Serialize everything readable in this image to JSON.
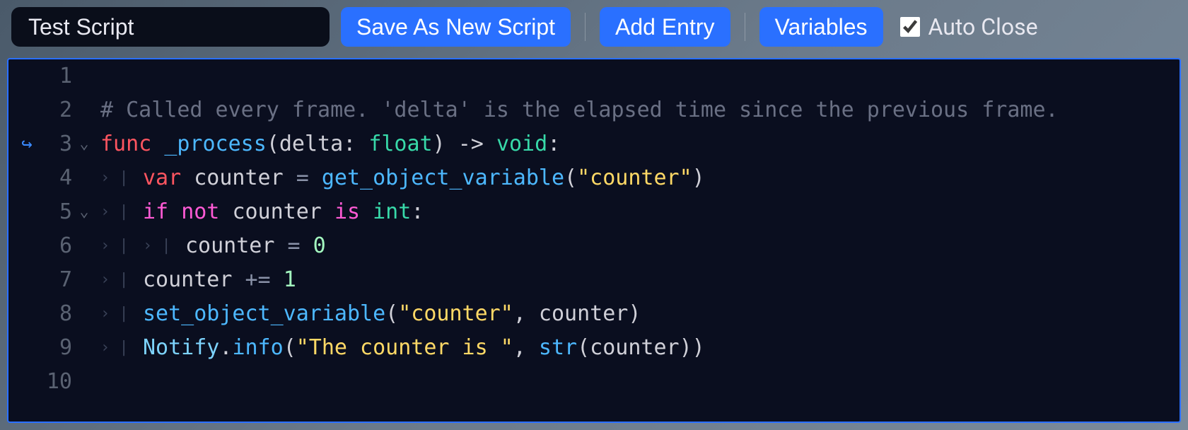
{
  "toolbar": {
    "script_name": "Test Script",
    "save_label": "Save As New Script",
    "add_entry_label": "Add Entry",
    "variables_label": "Variables",
    "auto_close_label": "Auto Close",
    "auto_close_checked": true
  },
  "editor": {
    "lines": [
      {
        "num": "1",
        "gutter": "",
        "fold": "",
        "indent": "",
        "tokens": []
      },
      {
        "num": "2",
        "gutter": "",
        "fold": "",
        "indent": "",
        "tokens": [
          {
            "t": "# Called every frame. 'delta' is the elapsed time since the previous frame.",
            "c": "c-comment"
          }
        ]
      },
      {
        "num": "3",
        "gutter": "↪",
        "fold": "⌄",
        "indent": "",
        "tokens": [
          {
            "t": "func ",
            "c": "c-key-func"
          },
          {
            "t": "_process",
            "c": "c-funcname"
          },
          {
            "t": "(",
            "c": "c-punc"
          },
          {
            "t": "delta",
            "c": "c-ident"
          },
          {
            "t": ": ",
            "c": "c-punc"
          },
          {
            "t": "float",
            "c": "c-type"
          },
          {
            "t": ") -> ",
            "c": "c-punc"
          },
          {
            "t": "void",
            "c": "c-type"
          },
          {
            "t": ":",
            "c": "c-punc"
          }
        ]
      },
      {
        "num": "4",
        "gutter": "",
        "fold": "",
        "indent": "›|  ",
        "tokens": [
          {
            "t": "var ",
            "c": "c-key-var"
          },
          {
            "t": "counter ",
            "c": "c-ident"
          },
          {
            "t": "= ",
            "c": "c-op"
          },
          {
            "t": "get_object_variable",
            "c": "c-call"
          },
          {
            "t": "(",
            "c": "c-punc"
          },
          {
            "t": "\"counter\"",
            "c": "c-string"
          },
          {
            "t": ")",
            "c": "c-punc"
          }
        ]
      },
      {
        "num": "5",
        "gutter": "",
        "fold": "⌄",
        "indent": "›|  ",
        "tokens": [
          {
            "t": "if ",
            "c": "c-key-ctrl"
          },
          {
            "t": "not ",
            "c": "c-key-ctrl"
          },
          {
            "t": "counter ",
            "c": "c-ident"
          },
          {
            "t": "is ",
            "c": "c-key-ctrl"
          },
          {
            "t": "int",
            "c": "c-type"
          },
          {
            "t": ":",
            "c": "c-punc"
          }
        ]
      },
      {
        "num": "6",
        "gutter": "",
        "fold": "",
        "indent": "›|  ›|  ",
        "tokens": [
          {
            "t": "counter ",
            "c": "c-ident"
          },
          {
            "t": "= ",
            "c": "c-op"
          },
          {
            "t": "0",
            "c": "c-num"
          }
        ]
      },
      {
        "num": "7",
        "gutter": "",
        "fold": "",
        "indent": "›|  ",
        "tokens": [
          {
            "t": "counter ",
            "c": "c-ident"
          },
          {
            "t": "+= ",
            "c": "c-op"
          },
          {
            "t": "1",
            "c": "c-num"
          }
        ]
      },
      {
        "num": "8",
        "gutter": "",
        "fold": "",
        "indent": "›|  ",
        "tokens": [
          {
            "t": "set_object_variable",
            "c": "c-call"
          },
          {
            "t": "(",
            "c": "c-punc"
          },
          {
            "t": "\"counter\"",
            "c": "c-string"
          },
          {
            "t": ", ",
            "c": "c-punc"
          },
          {
            "t": "counter",
            "c": "c-ident"
          },
          {
            "t": ")",
            "c": "c-punc"
          }
        ]
      },
      {
        "num": "9",
        "gutter": "",
        "fold": "",
        "indent": "›|  ",
        "tokens": [
          {
            "t": "Notify",
            "c": "c-class"
          },
          {
            "t": ".",
            "c": "c-punc"
          },
          {
            "t": "info",
            "c": "c-method"
          },
          {
            "t": "(",
            "c": "c-punc"
          },
          {
            "t": "\"The counter is \"",
            "c": "c-string"
          },
          {
            "t": ", ",
            "c": "c-punc"
          },
          {
            "t": "str",
            "c": "c-call"
          },
          {
            "t": "(",
            "c": "c-punc"
          },
          {
            "t": "counter",
            "c": "c-ident"
          },
          {
            "t": "))",
            "c": "c-punc"
          }
        ]
      },
      {
        "num": "10",
        "gutter": "",
        "fold": "",
        "indent": "",
        "tokens": []
      }
    ]
  }
}
